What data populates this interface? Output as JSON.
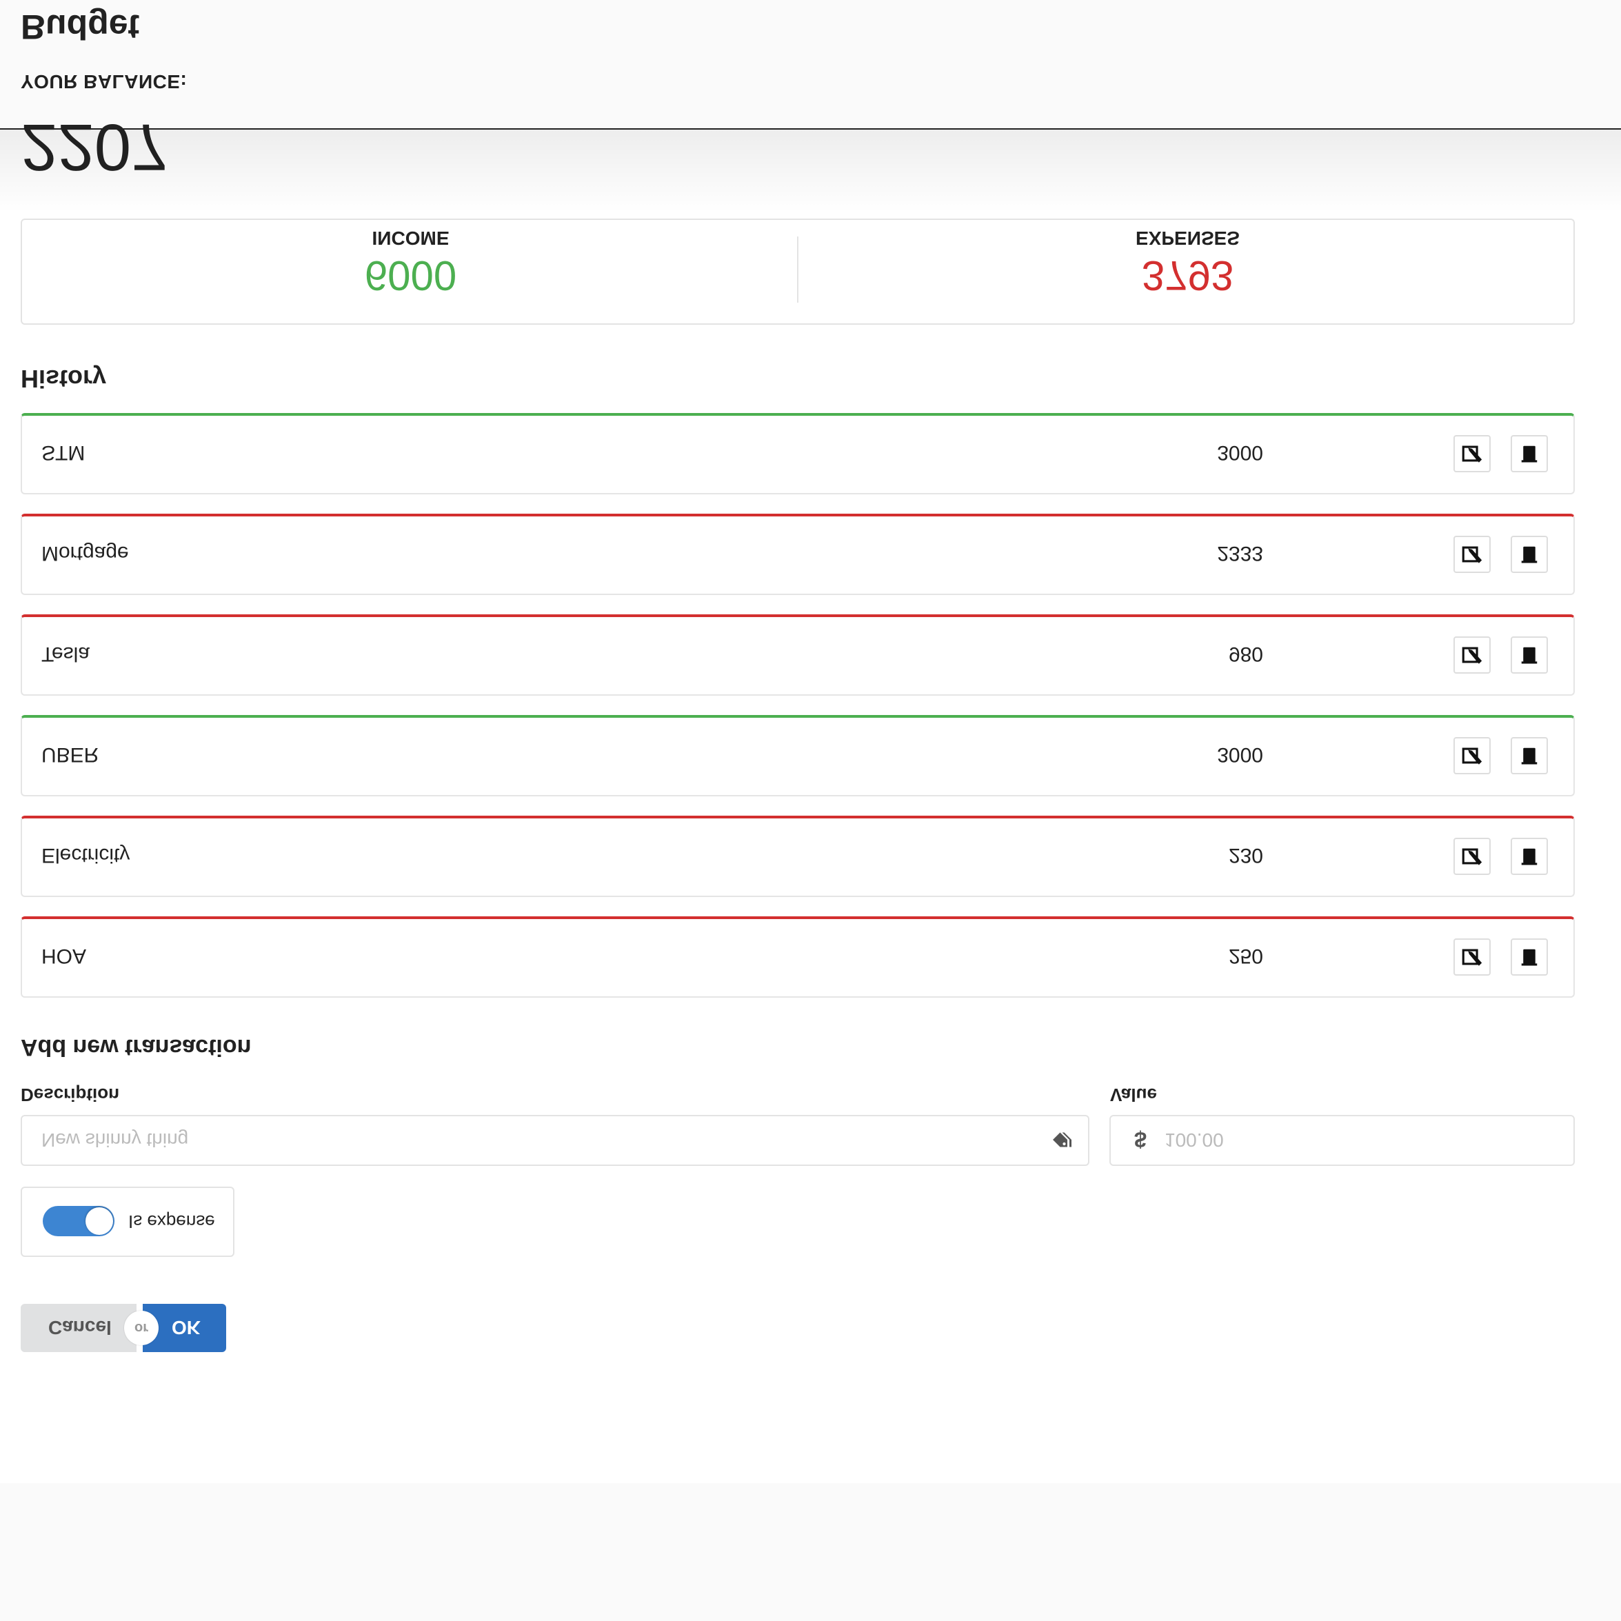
{
  "budget": {
    "title": "Budget",
    "balance_label": "YOUR BALANCE:",
    "balance_value": "2207"
  },
  "stats": {
    "income_value": "6000",
    "income_label": "INCOME",
    "expenses_value": "3793",
    "expenses_label": "EXPENSES",
    "income_color": "#4caf50",
    "expense_color": "#d32f2f"
  },
  "history": {
    "title": "History",
    "rows": [
      {
        "description": "STM",
        "value": "3000",
        "type": "income"
      },
      {
        "description": "Mortgage",
        "value": "2333",
        "type": "expense"
      },
      {
        "description": "Tesla",
        "value": "980",
        "type": "expense"
      },
      {
        "description": "UBER",
        "value": "3000",
        "type": "income"
      },
      {
        "description": "Electricity",
        "value": "230",
        "type": "expense"
      },
      {
        "description": "HOA",
        "value": "250",
        "type": "expense"
      }
    ]
  },
  "form": {
    "title": "Add new transaction",
    "description_label": "Description",
    "description_placeholder": "New shinny thing",
    "value_label": "Value",
    "currency_symbol": "$",
    "value_placeholder": "100.00",
    "is_expense_label": "Is expense",
    "is_expense_on": true,
    "cancel_label": "Cancel",
    "or_label": "or",
    "ok_label": "OK",
    "toggle_color": "#3d85d2",
    "ok_color": "#2c6fc0"
  }
}
